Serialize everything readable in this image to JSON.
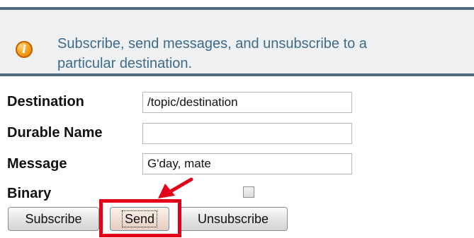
{
  "info": {
    "icon": "info-icon",
    "icon_glyph": "i",
    "line1": "Subscribe, send messages, and unsubscribe to a",
    "line2": "particular destination."
  },
  "form": {
    "destination_label": "Destination",
    "destination_value": "/topic/destination",
    "durable_label": "Durable Name",
    "durable_value": "",
    "message_label": "Message",
    "message_value": "G'day, mate",
    "binary_label": "Binary",
    "binary_checked": false
  },
  "buttons": {
    "subscribe": "Subscribe",
    "send": "Send",
    "unsubscribe": "Unsubscribe"
  },
  "annotation": {
    "highlight_color": "#e3001b",
    "target": "send-button"
  },
  "colors": {
    "rule": "#4d6a7d",
    "info_text": "#3f6b8b",
    "info_background": "#eef0f1"
  }
}
